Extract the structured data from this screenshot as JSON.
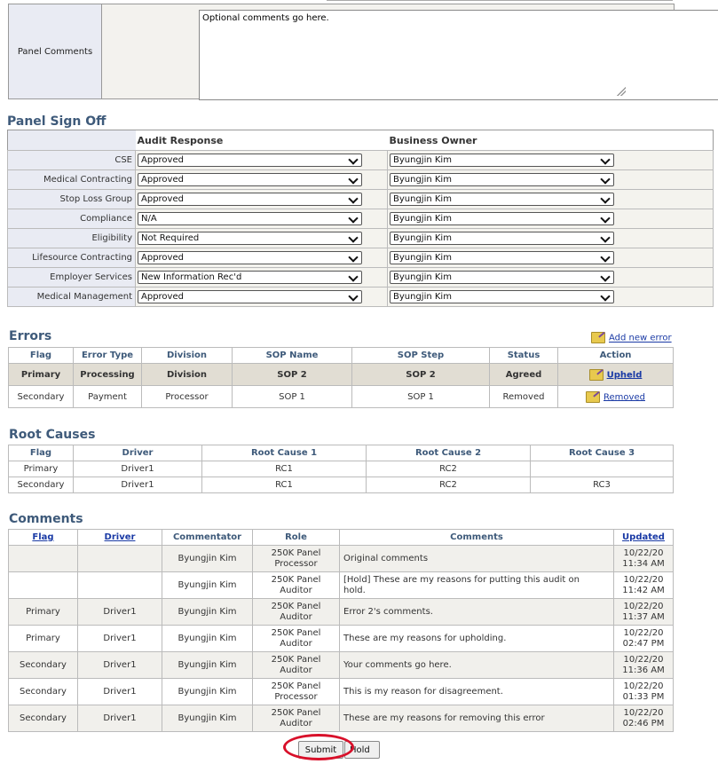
{
  "panel_comments": {
    "label": "Panel Comments",
    "value": "Optional comments go here."
  },
  "signoff": {
    "title": "Panel Sign Off",
    "col_audit": "Audit Response",
    "col_owner": "Business Owner",
    "rows": [
      {
        "label": "CSE",
        "audit": "Approved",
        "owner": "Byungjin Kim"
      },
      {
        "label": "Medical Contracting",
        "audit": "Approved",
        "owner": "Byungjin Kim"
      },
      {
        "label": "Stop Loss Group",
        "audit": "Approved",
        "owner": "Byungjin Kim"
      },
      {
        "label": "Compliance",
        "audit": "N/A",
        "owner": "Byungjin Kim"
      },
      {
        "label": "Eligibility",
        "audit": "Not Required",
        "owner": "Byungjin Kim"
      },
      {
        "label": "Lifesource Contracting",
        "audit": "Approved",
        "owner": "Byungjin Kim"
      },
      {
        "label": "Employer Services",
        "audit": "New Information Rec'd",
        "owner": "Byungjin Kim"
      },
      {
        "label": "Medical Management",
        "audit": "Approved",
        "owner": "Byungjin Kim"
      }
    ]
  },
  "errors": {
    "title": "Errors",
    "add_new": "Add new error",
    "headers": [
      "Flag",
      "Error Type",
      "Division",
      "SOP Name",
      "SOP Step",
      "Status",
      "Action"
    ],
    "rows": [
      {
        "flag": "Primary",
        "error_type": "Processing",
        "division": "Division",
        "sop_name": "SOP 2",
        "sop_step": "SOP 2",
        "status": "Agreed",
        "action": "Upheld"
      },
      {
        "flag": "Secondary",
        "error_type": "Payment",
        "division": "Processor",
        "sop_name": "SOP 1",
        "sop_step": "SOP 1",
        "status": "Removed",
        "action": "Removed"
      }
    ]
  },
  "root_causes": {
    "title": "Root Causes",
    "headers": [
      "Flag",
      "Driver",
      "Root Cause 1",
      "Root Cause 2",
      "Root Cause 3"
    ],
    "rows": [
      {
        "flag": "Primary",
        "driver": "Driver1",
        "rc1": "RC1",
        "rc2": "RC2",
        "rc3": ""
      },
      {
        "flag": "Secondary",
        "driver": "Driver1",
        "rc1": "RC1",
        "rc2": "RC2",
        "rc3": "RC3"
      }
    ]
  },
  "comments": {
    "title": "Comments",
    "headers": {
      "flag": "Flag",
      "driver": "Driver",
      "commentator": "Commentator",
      "role": "Role",
      "comments": "Comments",
      "updated": "Updated"
    },
    "rows": [
      {
        "flag": "",
        "driver": "",
        "commentator": "Byungjin Kim",
        "role_1": "250K Panel",
        "role_2": "Processor",
        "comment": "Original comments",
        "date": "10/22/20",
        "time": "11:34 AM"
      },
      {
        "flag": "",
        "driver": "",
        "commentator": "Byungjin Kim",
        "role_1": "250K Panel",
        "role_2": "Auditor",
        "comment": "[Hold] These are my reasons for putting this audit on",
        "comment_2": "hold.",
        "date": "10/22/20",
        "time": "11:42 AM"
      },
      {
        "flag": "Primary",
        "driver": "Driver1",
        "commentator": "Byungjin Kim",
        "role_1": "250K Panel",
        "role_2": "Auditor",
        "comment": "Error 2's comments.",
        "date": "10/22/20",
        "time": "11:37 AM"
      },
      {
        "flag": "Primary",
        "driver": "Driver1",
        "commentator": "Byungjin Kim",
        "role_1": "250K Panel",
        "role_2": "Auditor",
        "comment": "These are my reasons for upholding.",
        "date": "10/22/20",
        "time": "02:47 PM"
      },
      {
        "flag": "Secondary",
        "driver": "Driver1",
        "commentator": "Byungjin Kim",
        "role_1": "250K Panel",
        "role_2": "Auditor",
        "comment": "Your comments go here.",
        "date": "10/22/20",
        "time": "11:36 AM"
      },
      {
        "flag": "Secondary",
        "driver": "Driver1",
        "commentator": "Byungjin Kim",
        "role_1": "250K Panel",
        "role_2": "Processor",
        "comment": "This is my reason for disagreement.",
        "date": "10/22/20",
        "time": "01:33 PM"
      },
      {
        "flag": "Secondary",
        "driver": "Driver1",
        "commentator": "Byungjin Kim",
        "role_1": "250K Panel",
        "role_2": "Auditor",
        "comment": "These are my reasons for removing this error",
        "date": "10/22/20",
        "time": "02:46 PM"
      }
    ]
  },
  "buttons": {
    "submit": "Submit",
    "hold": "Hold"
  },
  "colors": {
    "section_title": "#3e5a7a",
    "link": "#1a3aa5",
    "highlight_circle": "#d8102a"
  }
}
